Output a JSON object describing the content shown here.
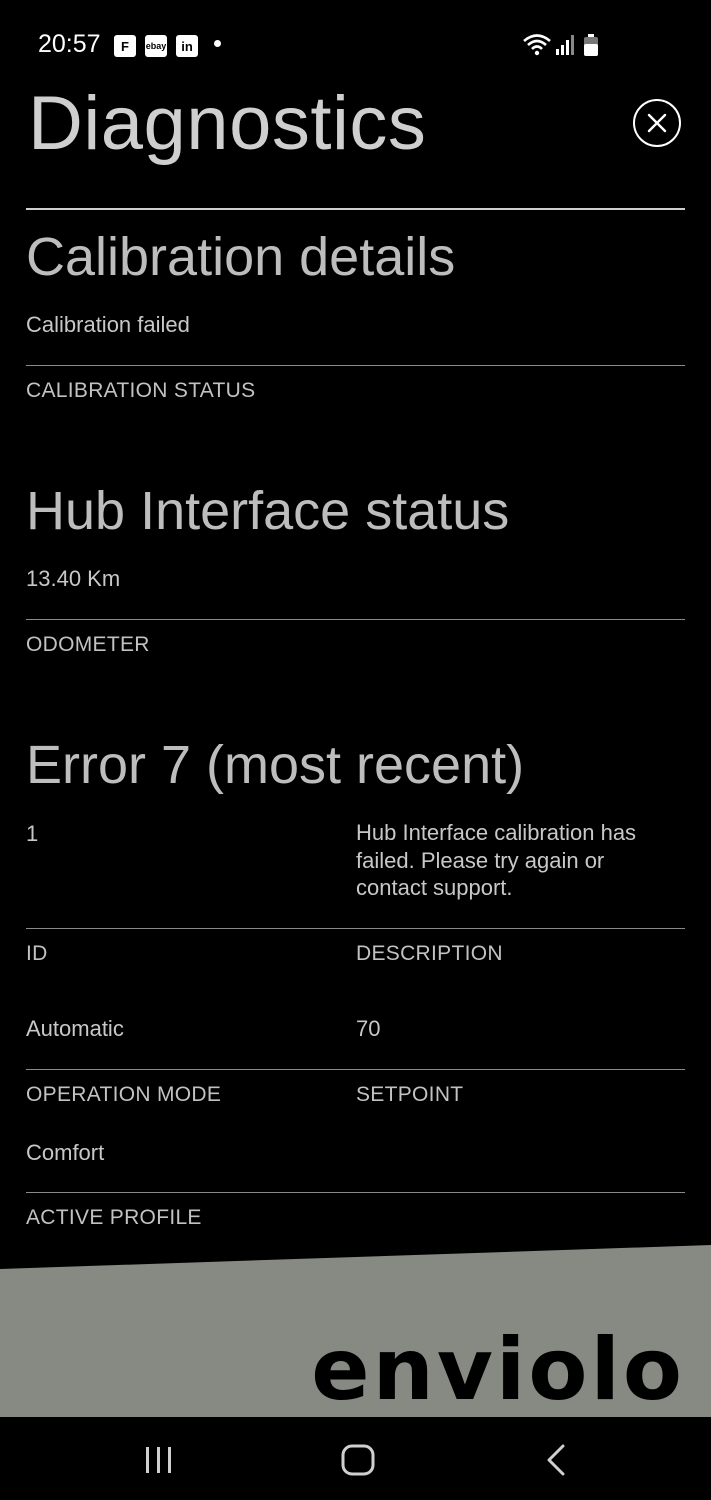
{
  "status_bar": {
    "time": "20:57",
    "apps": [
      "F",
      "ebay",
      "in"
    ]
  },
  "header": {
    "title": "Diagnostics"
  },
  "calibration": {
    "title": "Calibration details",
    "status_value": "Calibration failed",
    "status_label": "CALIBRATION STATUS"
  },
  "hub": {
    "title": "Hub Interface status",
    "odometer_value": "13.40 Km",
    "odometer_label": "ODOMETER"
  },
  "error": {
    "title": "Error 7 (most recent)",
    "id_value": "1",
    "description_value": "Hub Interface calibration has failed. Please try again or contact support.",
    "id_label": "ID",
    "description_label": "DESCRIPTION",
    "operation_mode_value": "Automatic",
    "setpoint_value": "70",
    "operation_mode_label": "OPERATION MODE",
    "setpoint_label": "SETPOINT",
    "active_profile_value": "Comfort",
    "active_profile_label": "ACTIVE PROFILE"
  },
  "brand": {
    "logo": "enviolo",
    "banner_color": "#868a82"
  }
}
